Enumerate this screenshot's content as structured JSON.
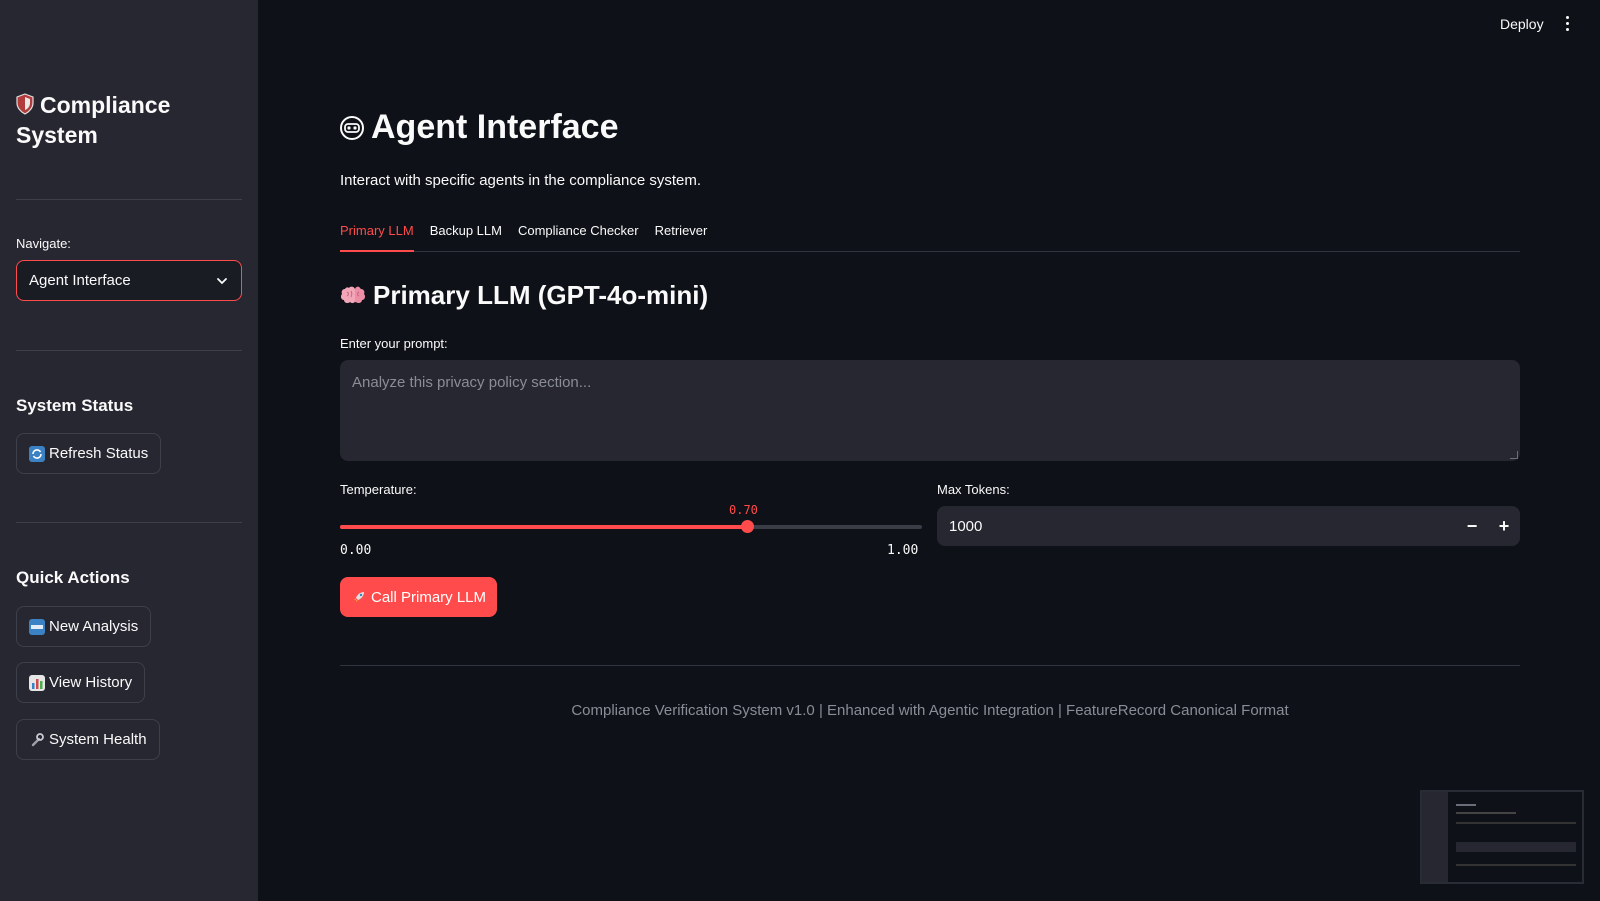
{
  "sidebar": {
    "title": "Compliance System",
    "navigate_label": "Navigate:",
    "navigate_value": "Agent Interface",
    "system_status_heading": "System Status",
    "refresh_status_label": "Refresh Status",
    "quick_actions_heading": "Quick Actions",
    "new_analysis_label": "New Analysis",
    "view_history_label": "View History",
    "system_health_label": "System Health"
  },
  "header": {
    "deploy_label": "Deploy"
  },
  "main": {
    "title": "Agent Interface",
    "subtitle": "Interact with specific agents in the compliance system.",
    "tabs": [
      {
        "label": "Primary LLM",
        "active": true
      },
      {
        "label": "Backup LLM",
        "active": false
      },
      {
        "label": "Compliance Checker",
        "active": false
      },
      {
        "label": "Retriever",
        "active": false
      }
    ],
    "section_title": "Primary LLM (GPT-4o-mini)",
    "prompt_label": "Enter your prompt:",
    "prompt_placeholder": "Analyze this privacy policy section...",
    "temperature_label": "Temperature:",
    "temperature": {
      "value": 0.7,
      "display": "0.70",
      "min": 0,
      "max": 1,
      "min_label": "0.00",
      "max_label": "1.00"
    },
    "max_tokens_label": "Max Tokens:",
    "max_tokens_value": "1000",
    "decrement_label": "−",
    "increment_label": "+",
    "call_button_label": "Call Primary LLM",
    "footer": "Compliance Verification System v1.0 | Enhanced with Agentic Integration | FeatureRecord Canonical Format"
  },
  "icons": {
    "sidebar_title": "shield-icon",
    "refresh": "refresh-icon",
    "new_analysis": "new-badge-icon",
    "view_history": "bar-chart-icon",
    "system_health": "wrench-icon",
    "page_title": "robot-face-icon",
    "section_title": "brain-icon",
    "call_button": "rocket-icon"
  },
  "colors": {
    "accent": "#ff4b4b",
    "background": "#0e1117",
    "sidebar": "#262730",
    "text": "#fafafa",
    "muted": "#8a8d97"
  }
}
